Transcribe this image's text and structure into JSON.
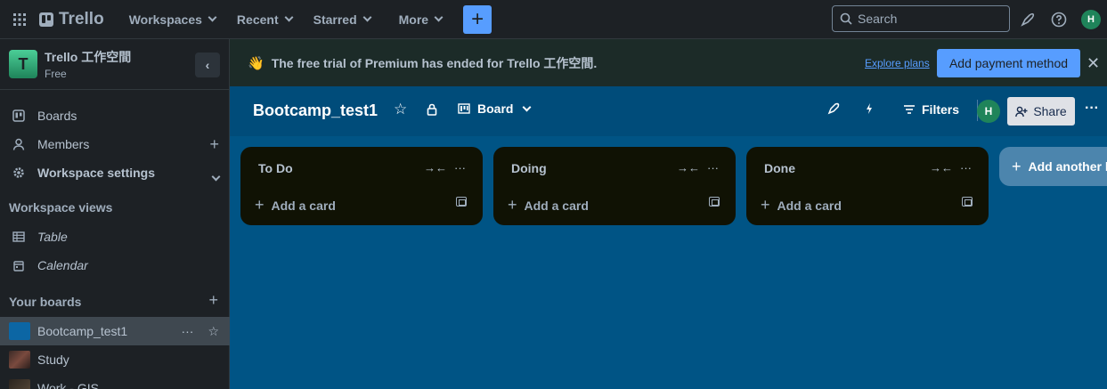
{
  "topnav": {
    "brand": "Trello",
    "items": [
      {
        "label": "Workspaces"
      },
      {
        "label": "Recent"
      },
      {
        "label": "Starred"
      },
      {
        "label": "More"
      }
    ],
    "create_symbol": "+",
    "search_placeholder": "Search",
    "avatar_initial": "H"
  },
  "sidebar": {
    "workspace_initial": "T",
    "workspace_name": "Trello 工作空間",
    "workspace_plan": "Free",
    "items": [
      {
        "label": "Boards",
        "icon": "board-icon"
      },
      {
        "label": "Members",
        "icon": "person-icon"
      },
      {
        "label": "Workspace settings",
        "icon": "gear-icon"
      }
    ],
    "views_title": "Workspace views",
    "views": [
      {
        "label": "Table",
        "icon": "table-icon"
      },
      {
        "label": "Calendar",
        "icon": "calendar-icon"
      }
    ],
    "boards_title": "Your boards",
    "boards": [
      {
        "label": "Bootcamp_test1",
        "color": "#0c66a4",
        "active": true
      },
      {
        "label": "Study",
        "color": "#5a3a2e"
      },
      {
        "label": "Work - GIS",
        "color": "#3a2e22"
      }
    ]
  },
  "banner": {
    "emoji": "👋",
    "message": "The free trial of Premium has ended for Trello 工作空間.",
    "explore": "Explore plans",
    "pay": "Add payment method"
  },
  "board": {
    "title": "Bootcamp_test1",
    "view": "Board",
    "filters": "Filters",
    "share": "Share",
    "member_initial": "H"
  },
  "lists": [
    {
      "name": "To Do",
      "add": "Add a card"
    },
    {
      "name": "Doing",
      "add": "Add a card"
    },
    {
      "name": "Done",
      "add": "Add a card"
    }
  ],
  "add_list": "Add another list",
  "colors": {
    "accent": "#579dff",
    "board_bg": "#005485",
    "list_bg": "#101204"
  }
}
